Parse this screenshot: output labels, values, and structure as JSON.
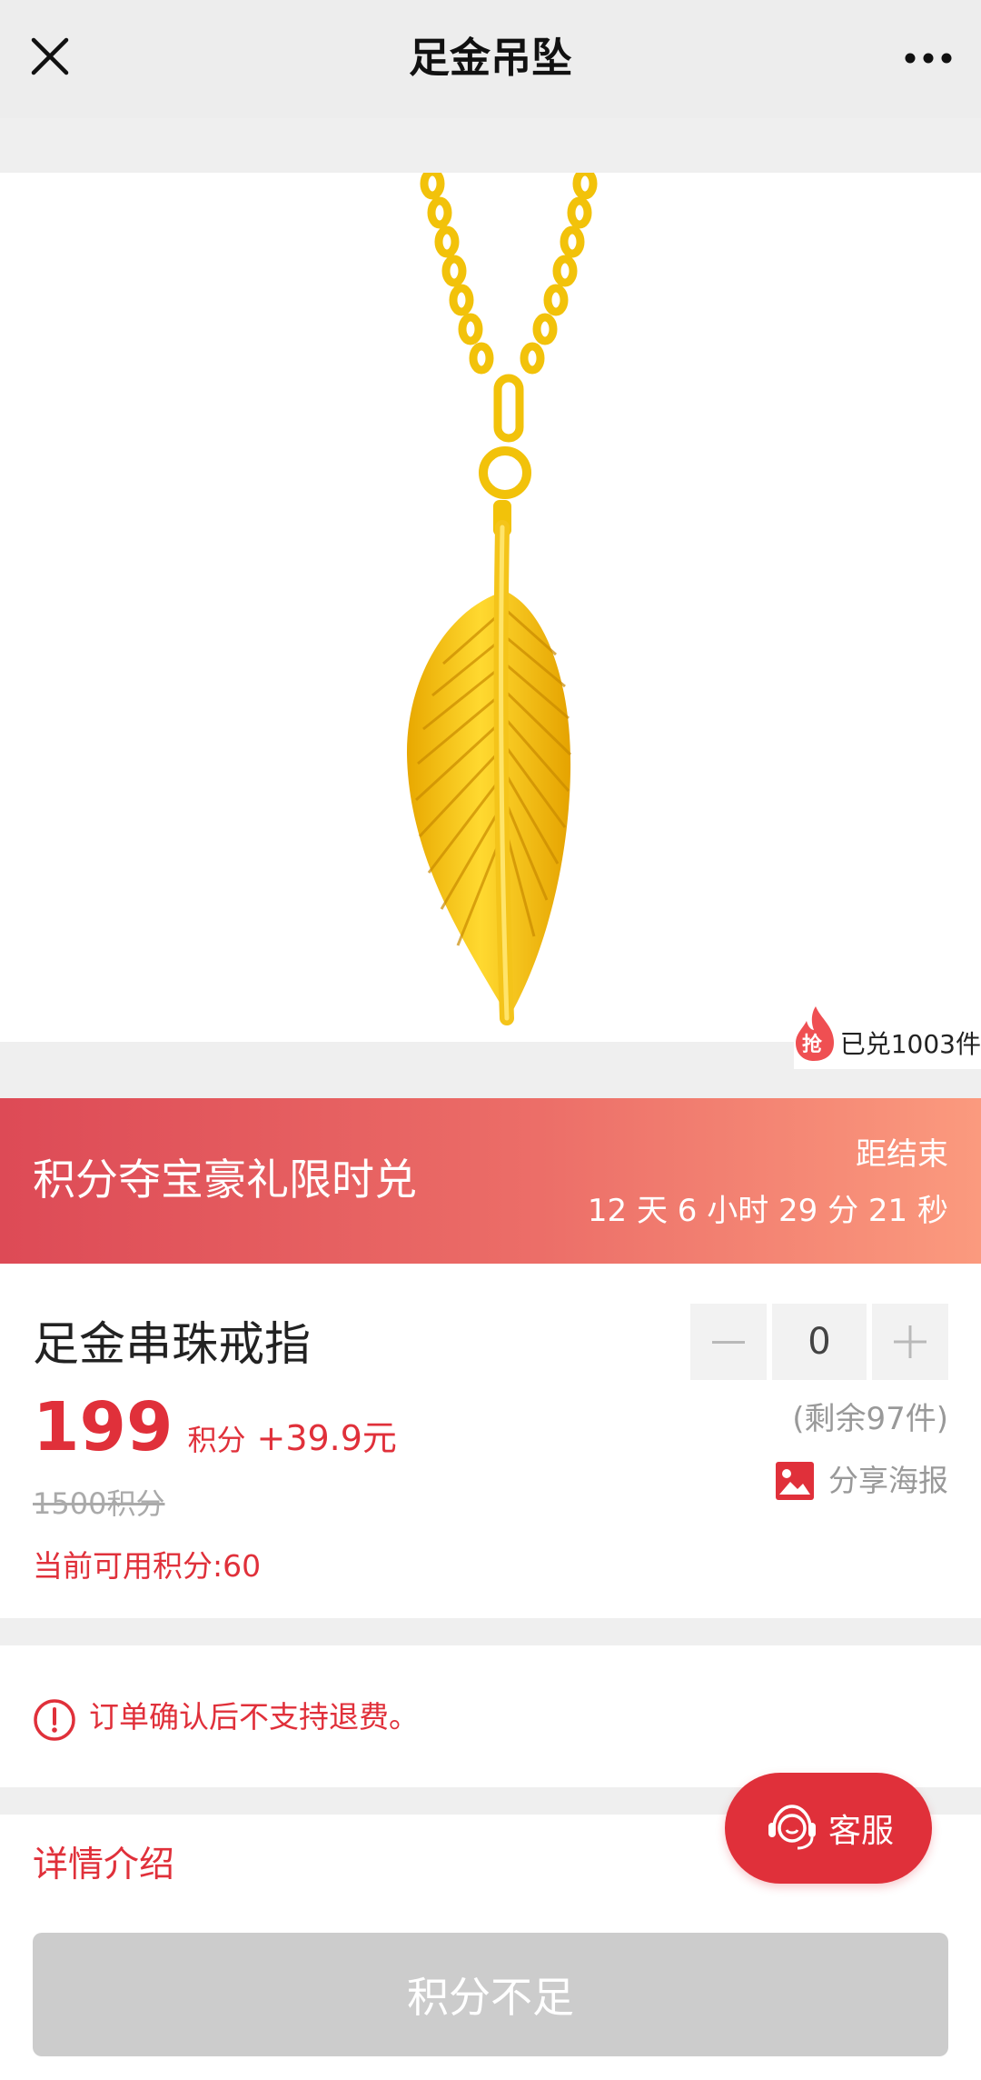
{
  "nav": {
    "title": "足金吊坠",
    "close_icon": "close-icon",
    "more_icon": "more-icon"
  },
  "sold_badge": {
    "fire_text": "抢",
    "text": "已兑1003件"
  },
  "banner": {
    "title": "积分夺宝豪礼限时兑",
    "end_label": "距结束",
    "countdown": "12 天 6 小时 29 分 21 秒"
  },
  "product": {
    "name": "足金串珠戒指",
    "price": "199",
    "price_unit": "积分",
    "price_cash": "+39.9元",
    "original_price": "1500积分",
    "current_points": "当前可用积分:60"
  },
  "stepper": {
    "value": "0"
  },
  "stock": "(剩余97件)",
  "share": {
    "label": "分享海报",
    "icon": "poster-icon"
  },
  "notice": {
    "text": "订单确认后不支持退费。",
    "icon": "alert-icon"
  },
  "detail": {
    "title": "详情介绍"
  },
  "service": {
    "label": "客服",
    "icon": "headset-icon"
  },
  "submit": {
    "label": "积分不足"
  },
  "colors": {
    "accent": "#e0303a",
    "banner_start": "#dd4a56",
    "banner_end": "#fb9a7e",
    "disabled": "#cccccc"
  }
}
